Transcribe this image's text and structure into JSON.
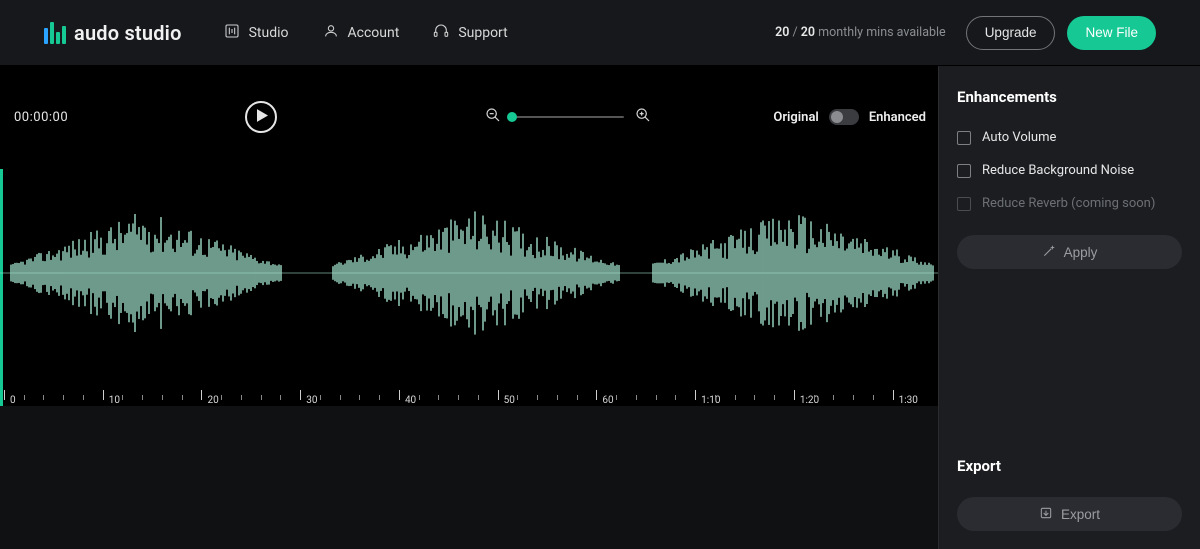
{
  "brand": {
    "name": "audo studio"
  },
  "nav": {
    "studio": "Studio",
    "account": "Account",
    "support": "Support"
  },
  "quota": {
    "used": "20",
    "total": "20",
    "suffix": "monthly mins available"
  },
  "header_buttons": {
    "upgrade": "Upgrade",
    "new_file": "New File"
  },
  "controls": {
    "timecode": "00:00:00",
    "original_label": "Original",
    "enhanced_label": "Enhanced"
  },
  "ruler": {
    "labels": [
      "0",
      "10",
      "20",
      "30",
      "40",
      "50",
      "60",
      "1:10",
      "1:20",
      "1:30"
    ]
  },
  "sidebar": {
    "enhancements_title": "Enhancements",
    "opts": {
      "auto_volume": "Auto Volume",
      "reduce_noise": "Reduce Background Noise",
      "reduce_reverb": "Reduce Reverb (coming soon)"
    },
    "apply_label": "Apply",
    "export_title": "Export",
    "export_label": "Export"
  },
  "colors": {
    "accent": "#15c894",
    "wave": "#9eddc9"
  }
}
